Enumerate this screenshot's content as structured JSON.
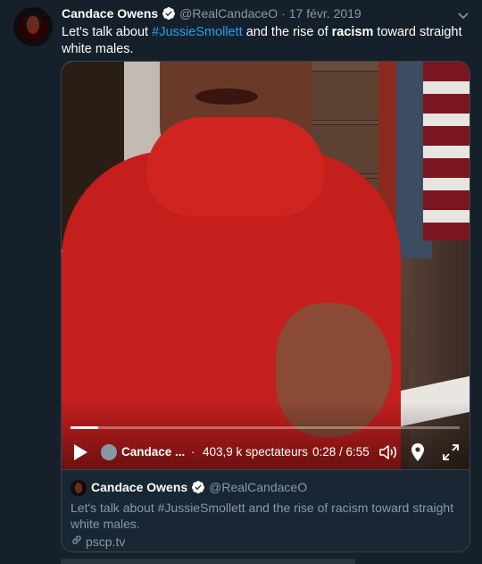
{
  "tweet": {
    "author_name": "Candace Owens",
    "handle": "@RealCandaceO",
    "separator": "·",
    "date": "17 févr. 2019",
    "text_part1": "Let's talk about ",
    "hashtag": "#JussieSmollett",
    "text_part2": " and the rise of ",
    "bold_word": "racism",
    "text_part3": " toward straight white males."
  },
  "player": {
    "broadcaster": "Candace ...",
    "separator": "·",
    "viewers": "403,9 k spectateurs",
    "time": "0:28 / 6:55",
    "progress": 0.07
  },
  "card": {
    "author_name": "Candace Owens",
    "handle": "@RealCandaceO",
    "text": "Let's talk about #JussieSmollett and the rise of racism toward straight white males.",
    "link": "pscp.tv"
  },
  "colors": {
    "background": "#15202b",
    "link": "#1da1f2",
    "muted": "#8899a6",
    "border": "#38444d"
  },
  "icons": [
    "verified-badge-icon",
    "chevron-down-icon",
    "play-icon",
    "volume-icon",
    "location-pin-icon",
    "fullscreen-icon",
    "link-icon"
  ]
}
